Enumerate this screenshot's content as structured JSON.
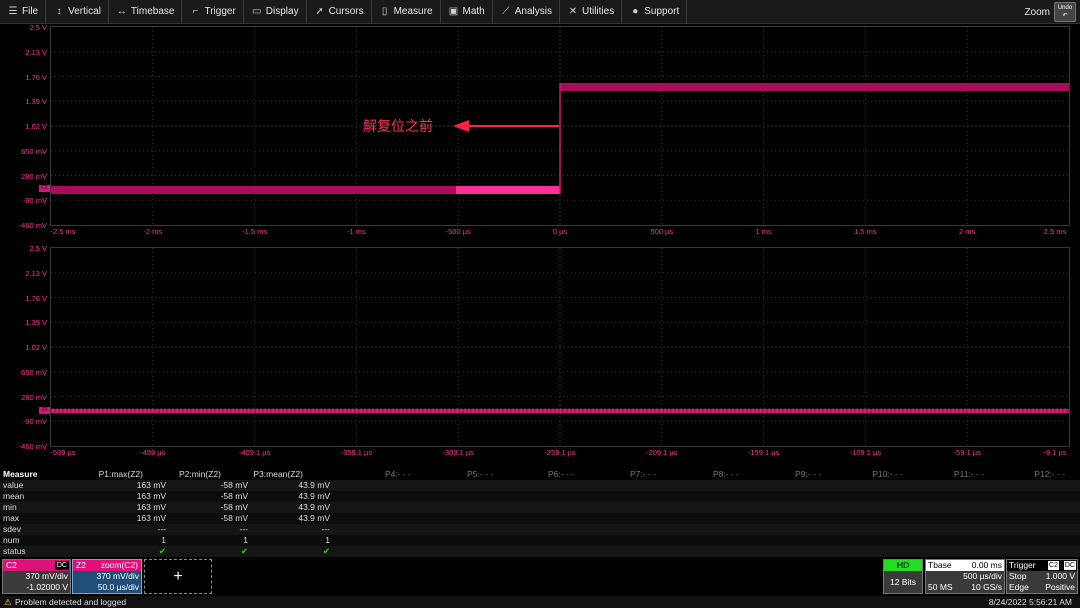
{
  "menu": {
    "items": [
      {
        "icon": "file-icon",
        "glyph": "☰",
        "label": "File"
      },
      {
        "icon": "vertical-icon",
        "glyph": "↕",
        "label": "Vertical"
      },
      {
        "icon": "timebase-icon",
        "glyph": "↔",
        "label": "Timebase"
      },
      {
        "icon": "trigger-icon",
        "glyph": "⌐",
        "label": "Trigger"
      },
      {
        "icon": "display-icon",
        "glyph": "▭",
        "label": "Display"
      },
      {
        "icon": "cursors-icon",
        "glyph": "➚",
        "label": "Cursors"
      },
      {
        "icon": "measure-icon",
        "glyph": "▯",
        "label": "Measure"
      },
      {
        "icon": "math-icon",
        "glyph": "▣",
        "label": "Math"
      },
      {
        "icon": "analysis-icon",
        "glyph": "⟋",
        "label": "Analysis"
      },
      {
        "icon": "utilities-icon",
        "glyph": "✕",
        "label": "Utilities"
      },
      {
        "icon": "support-icon",
        "glyph": "●",
        "label": "Support"
      }
    ],
    "zoom": "Zoom",
    "undo": "Undo"
  },
  "upper_grid": {
    "y_labels": [
      "2.5 V",
      "2.13 V",
      "1.76 V",
      "1.39 V",
      "1.02 V",
      "650 mV",
      "280 mV",
      "-90 mV",
      "-460 mV"
    ],
    "x_labels": [
      "-2.5 ms",
      "-2 ms",
      "-1.5 ms",
      "-1 ms",
      "-500 µs",
      "0 µs",
      "500 µs",
      "1 ms",
      "1.5 ms",
      "2 ms",
      "2.5 ms"
    ],
    "annotation": "解复位之前",
    "trace_color": "#e0107a",
    "channel_marker": "C2"
  },
  "lower_grid": {
    "y_labels": [
      "2.5 V",
      "2.13 V",
      "1.76 V",
      "1.39 V",
      "1.02 V",
      "650 mV",
      "280 mV",
      "-90 mV",
      "-460 mV"
    ],
    "x_labels": [
      "-509 µs",
      "-459 µs",
      "-409.1 µs",
      "-359.1 µs",
      "-309.1 µs",
      "-259.1 µs",
      "-209.1 µs",
      "-159.1 µs",
      "-109.1 µs",
      "-59.1 µs",
      "-9.1 µs"
    ],
    "channel_marker": "Z2"
  },
  "measure": {
    "title": "Measure",
    "params": [
      "P1:max(Z2)",
      "P2:min(Z2)",
      "P3:mean(Z2)",
      "P4:- - -",
      "P5:- - -",
      "P6:- - -",
      "P7:- - -",
      "P8:- - -",
      "P9:- - -",
      "P10:- - -",
      "P11:- - -",
      "P12:- - -"
    ],
    "rows": [
      {
        "label": "value",
        "v": [
          "163 mV",
          "-58 mV",
          "43.9 mV"
        ]
      },
      {
        "label": "mean",
        "v": [
          "163 mV",
          "-58 mV",
          "43.9 mV"
        ]
      },
      {
        "label": "min",
        "v": [
          "163 mV",
          "-58 mV",
          "43.9 mV"
        ]
      },
      {
        "label": "max",
        "v": [
          "163 mV",
          "-58 mV",
          "43.9 mV"
        ]
      },
      {
        "label": "sdev",
        "v": [
          "---",
          "---",
          "---"
        ]
      },
      {
        "label": "num",
        "v": [
          "1",
          "1",
          "1"
        ]
      },
      {
        "label": "status",
        "v": [
          "✔",
          "✔",
          "✔"
        ]
      }
    ]
  },
  "descriptors": {
    "c2": {
      "name": "C2",
      "coupling": "DC",
      "scale": "370 mV/div",
      "offset": "-1.02000 V"
    },
    "z2": {
      "name": "Z2",
      "title": "zoom(C2)",
      "scale": "370 mV/div",
      "time": "50.0 µs/div"
    },
    "add": "+",
    "hd": {
      "label": "HD",
      "bits": "12 Bits"
    },
    "tbase": {
      "label": "Tbase",
      "delay": "0.00 ms",
      "rate": "500 µs/div",
      "samples": "50 MS",
      "srate": "10 GS/s"
    },
    "trigger": {
      "label": "Trigger",
      "ch": "C2",
      "coupling": "DC",
      "mode": "Stop",
      "level": "1.000 V",
      "type": "Edge",
      "slope": "Positive"
    }
  },
  "status": {
    "message": "Problem detected and logged",
    "timestamp": "8/24/2022 5:56:21 AM"
  }
}
